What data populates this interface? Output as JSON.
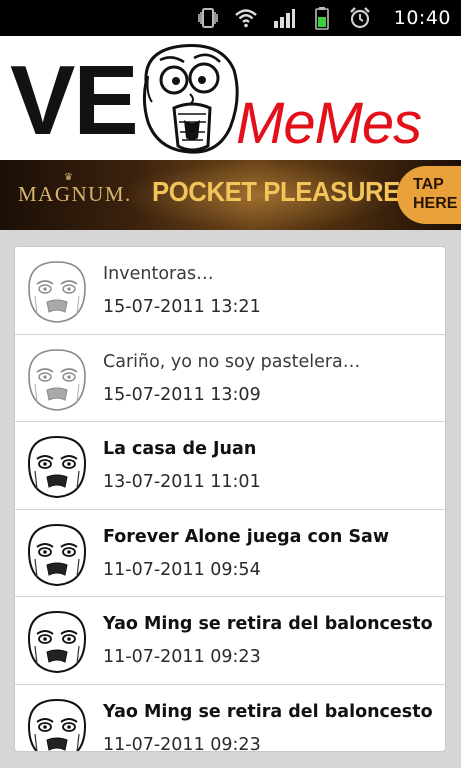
{
  "status_bar": {
    "time": "10:40",
    "icons": [
      "vibrate-icon",
      "wifi-icon",
      "signal-icon",
      "battery-icon",
      "alarm-icon"
    ],
    "battery_color": "#3fcf3a"
  },
  "header": {
    "logo_left": "VE",
    "logo_right": "MeMes",
    "logo_right_color": "#e3101a"
  },
  "ad": {
    "brand": "MAGNUM.",
    "headline": "POCKET PLEASURES",
    "cta": "TAP HERE"
  },
  "list": {
    "items": [
      {
        "title": "Inventoras…",
        "date": "15-07-2011 13:21",
        "read": true
      },
      {
        "title": "Cariño, yo no soy pastelera…",
        "date": "15-07-2011 13:09",
        "read": true
      },
      {
        "title": "La casa de Juan",
        "date": "13-07-2011 11:01",
        "read": false
      },
      {
        "title": "Forever Alone juega con Saw",
        "date": "11-07-2011 09:54",
        "read": false
      },
      {
        "title": "Yao Ming se retira del baloncesto",
        "date": "11-07-2011 09:23",
        "read": false
      },
      {
        "title": "Yao Ming se retira del baloncesto",
        "date": "11-07-2011 09:23",
        "read": false
      }
    ]
  }
}
